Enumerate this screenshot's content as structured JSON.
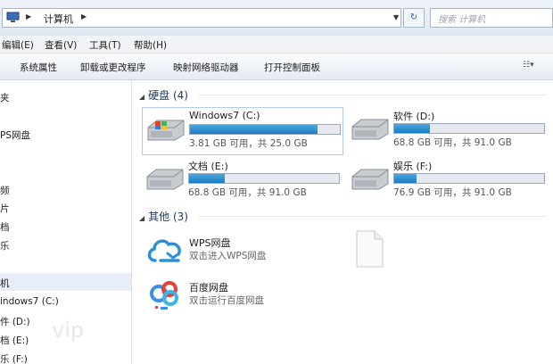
{
  "address": {
    "path": "计算机",
    "search_placeholder": "搜索 计算机"
  },
  "menu": [
    "编辑(E)",
    "查看(V)",
    "工具(T)",
    "帮助(H)"
  ],
  "commands": [
    "系统属性",
    "卸载或更改程序",
    "映射网络驱动器",
    "打开控制面板"
  ],
  "nav": [
    "夹",
    "PS网盘",
    "频",
    "片",
    "档",
    "乐",
    "机",
    "indows7 (C:)",
    "件 (D:)",
    "档 (E:)",
    "乐 (F:)"
  ],
  "sections": {
    "hdd": "硬盘 (4)",
    "other": "其他 (3)"
  },
  "drives": [
    {
      "name": "Windows7 (C:)",
      "info": "3.81 GB 可用，共 25.0 GB",
      "used_fraction": 0.85
    },
    {
      "name": "软件 (D:)",
      "info": "68.8 GB 可用，共 91.0 GB",
      "used_fraction": 0.24
    },
    {
      "name": "文档 (E:)",
      "info": "68.8 GB 可用，共 91.0 GB",
      "used_fraction": 0.24
    },
    {
      "name": "娱乐 (F:)",
      "info": "76.9 GB 可用，共 91.0 GB",
      "used_fraction": 0.15
    }
  ],
  "others": [
    {
      "name": "WPS网盘",
      "desc": "双击进入WPS网盘",
      "icon": "wps-cloud-icon"
    },
    {
      "name": "百度网盘",
      "desc": "双击运行百度网盘",
      "icon": "baidu-netdisk-icon"
    },
    {
      "icon": "blank-file-icon"
    }
  ],
  "watermark": "vip",
  "colors": {
    "progress": "#2a8ad4",
    "wps_cloud": "#2f8fd6",
    "baidu_blue": "#3d8ee8",
    "baidu_red": "#e2433b"
  }
}
